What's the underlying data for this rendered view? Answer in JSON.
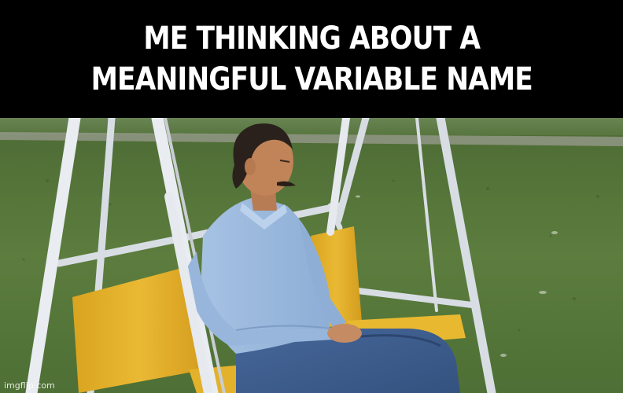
{
  "caption": {
    "line1": "ME THINKING ABOUT A",
    "line2": "MEANINGFUL VARIABLE NAME"
  },
  "watermark": "imgflip.com",
  "colors": {
    "band": "#000000",
    "caption_text": "#ffffff",
    "grass": "#5b7a3c",
    "swing_frame": "#e6e9ee",
    "cushion": "#e5b52a",
    "shirt": "#9bb9dd",
    "jeans": "#3f5f8f"
  }
}
